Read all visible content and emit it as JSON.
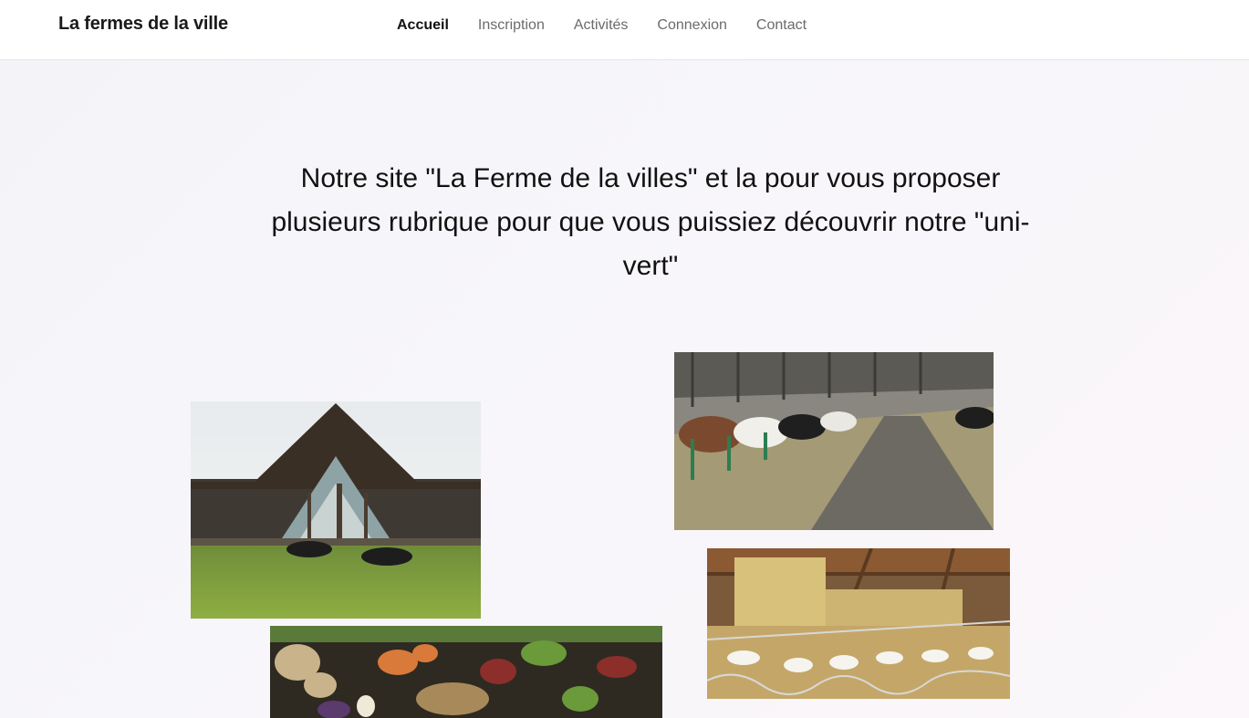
{
  "header": {
    "brand": "La fermes de la ville",
    "nav": [
      {
        "label": "Accueil",
        "active": true
      },
      {
        "label": "Inscription",
        "active": false
      },
      {
        "label": "Activités",
        "active": false
      },
      {
        "label": "Connexion",
        "active": false
      },
      {
        "label": "Contact",
        "active": false
      }
    ]
  },
  "main": {
    "intro": "Notre site \"La Ferme de la villes\" et la pour vous proposer plusieurs rubrique pour que vous puissiez découvrir notre \"uni-vert\""
  },
  "gallery": [
    {
      "name": "barn-photo"
    },
    {
      "name": "cows-stable-photo"
    },
    {
      "name": "goats-barn-photo"
    },
    {
      "name": "vegetables-market-photo"
    }
  ]
}
